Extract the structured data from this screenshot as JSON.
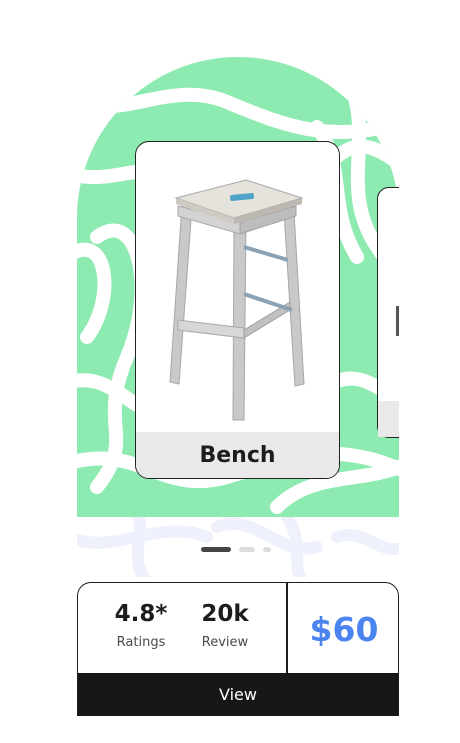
{
  "product": {
    "name": "Bench",
    "rating": "4.8*",
    "rating_label": "Ratings",
    "reviews": "20k",
    "reviews_label": "Review",
    "price": "$60"
  },
  "actions": {
    "view_label": "View"
  },
  "pagination": {
    "count": 3,
    "active_index": 0
  },
  "colors": {
    "hero_green": "#8deab0",
    "price_blue": "#4b83ef",
    "button_dark": "#171717",
    "label_bar": "#e9e9e9"
  }
}
